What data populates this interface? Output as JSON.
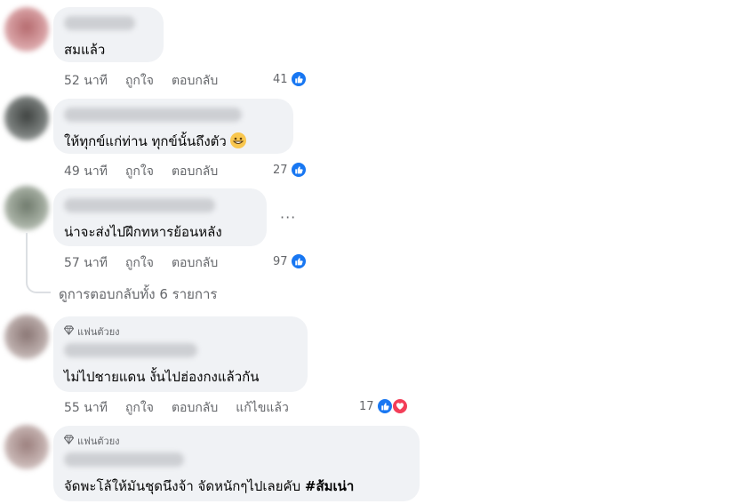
{
  "labels": {
    "like": "ถูกใจ",
    "reply": "ตอบกลับ",
    "edited": "แก้ไขแล้ว",
    "more": "···"
  },
  "comments": [
    {
      "text": "สมแล้ว",
      "time": "52 นาที",
      "reactions": "41"
    },
    {
      "text": "ให้ทุกข์แก่ท่าน ทุกข์นั้นถึงตัว",
      "emoji": "grinning-face-emoji",
      "time": "49 นาที",
      "reactions": "27"
    },
    {
      "text": "น่าจะส่งไปฝึกทหารย้อนหลัง",
      "time": "57 นาที",
      "reactions": "97",
      "view_replies": "ดูการตอบกลับทั้ง 6 รายการ"
    },
    {
      "badge": "แฟนตัวยง",
      "text": "ไม่ไปชายแดน งั้นไปฮ่องกงแล้วกัน",
      "time": "55 นาที",
      "reactions": "17"
    },
    {
      "badge": "แฟนตัวยง",
      "text": "จัดพะโล้ให้มันชุดนึงจ้า จัดหนักๆไปเลยคับ ",
      "hashtag": "#ส้มเน่า"
    }
  ],
  "colors": {
    "like_blue": "#1877f2",
    "love_red": "#f33e58",
    "bubble_bg": "#f0f2f5",
    "secondary_text": "#65676b"
  }
}
